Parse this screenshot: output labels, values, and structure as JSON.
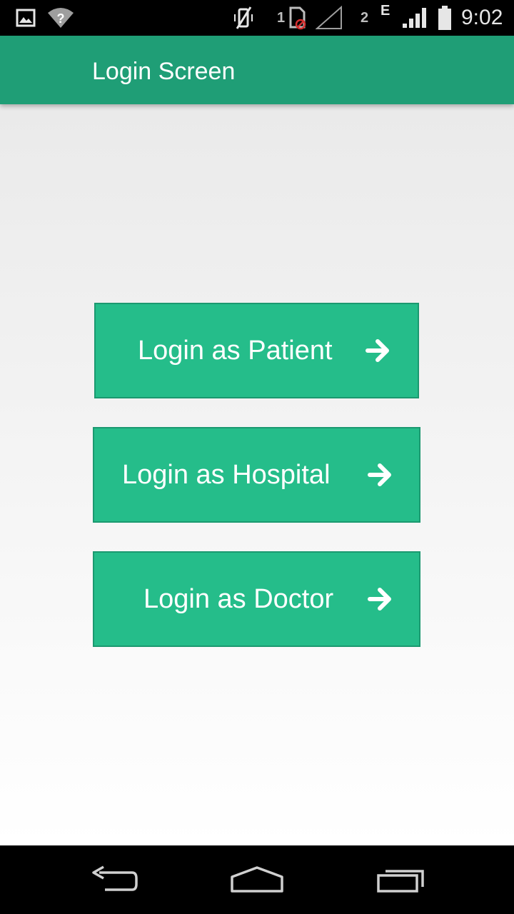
{
  "status_bar": {
    "sim1_label": "1",
    "sim2_label": "2",
    "network_type": "E",
    "time": "9:02",
    "icons": [
      "image-notification-icon",
      "wifi-question-icon",
      "vibrate-off-icon",
      "sim-blocked-icon",
      "signal-empty-icon",
      "signal-full-icon",
      "battery-icon"
    ]
  },
  "app_bar": {
    "title": "Login Screen"
  },
  "buttons": {
    "patient": "Login as Patient",
    "hospital": "Login as Hospital",
    "doctor": "Login as Doctor"
  },
  "nav_bar": {
    "icons": [
      "back-icon",
      "home-icon",
      "recent-apps-icon"
    ]
  },
  "colors": {
    "app_bar": "#1f9e76",
    "button": "#25bd8a",
    "button_border": "#1b9970",
    "status_bar": "#000000"
  }
}
